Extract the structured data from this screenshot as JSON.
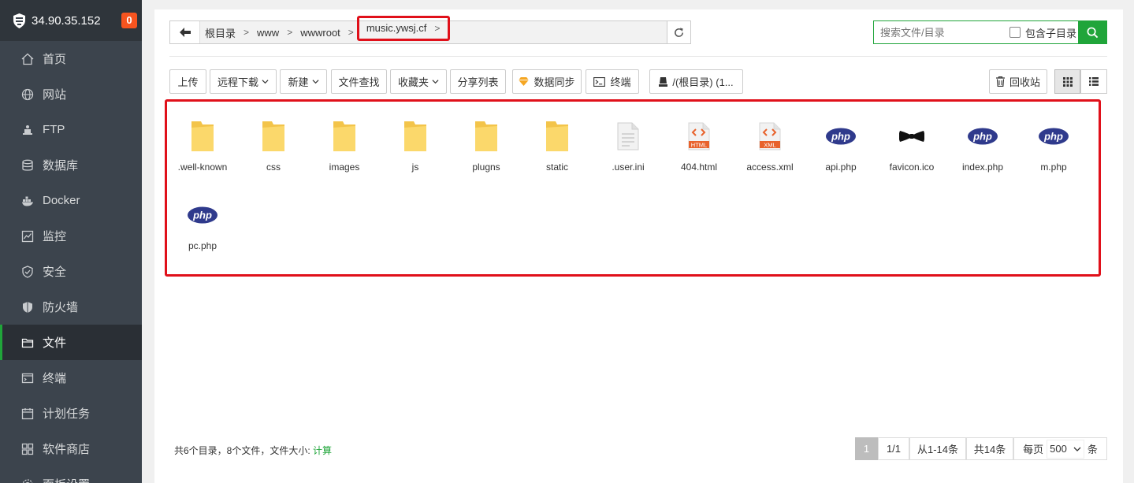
{
  "server": {
    "ip": "34.90.35.152",
    "badge": "0"
  },
  "sidebar": {
    "items": [
      {
        "label": "首页",
        "icon": "home-icon"
      },
      {
        "label": "网站",
        "icon": "globe-icon"
      },
      {
        "label": "FTP",
        "icon": "ftp-icon"
      },
      {
        "label": "数据库",
        "icon": "database-icon"
      },
      {
        "label": "Docker",
        "icon": "docker-icon"
      },
      {
        "label": "监控",
        "icon": "monitor-icon"
      },
      {
        "label": "安全",
        "icon": "shield-icon"
      },
      {
        "label": "防火墙",
        "icon": "firewall-icon"
      },
      {
        "label": "文件",
        "icon": "folder-icon",
        "active": true
      },
      {
        "label": "终端",
        "icon": "terminal-icon"
      },
      {
        "label": "计划任务",
        "icon": "calendar-icon"
      },
      {
        "label": "软件商店",
        "icon": "apps-icon"
      },
      {
        "label": "面板设置",
        "icon": "settings-icon"
      }
    ]
  },
  "path": {
    "crumbs": [
      "根目录",
      "www",
      "wwwroot",
      "music.ywsj.cf"
    ]
  },
  "search": {
    "placeholder": "搜索文件/目录",
    "include_sub_label": "包含子目录"
  },
  "toolbar": {
    "upload": "上传",
    "remote_download": "远程下载",
    "new": "新建",
    "find": "文件查找",
    "favorites": "收藏夹",
    "share_list": "分享列表",
    "data_sync": "数据同步",
    "terminal": "终端",
    "disk": "/(根目录) (1...",
    "recycle": "回收站"
  },
  "files": [
    {
      "name": ".well-known",
      "type": "folder"
    },
    {
      "name": "css",
      "type": "folder"
    },
    {
      "name": "images",
      "type": "folder"
    },
    {
      "name": "js",
      "type": "folder"
    },
    {
      "name": "plugns",
      "type": "folder"
    },
    {
      "name": "static",
      "type": "folder"
    },
    {
      "name": ".user.ini",
      "type": "text"
    },
    {
      "name": "404.html",
      "type": "html"
    },
    {
      "name": "access.xml",
      "type": "xml"
    },
    {
      "name": "api.php",
      "type": "php"
    },
    {
      "name": "favicon.ico",
      "type": "ico"
    },
    {
      "name": "index.php",
      "type": "php"
    },
    {
      "name": "m.php",
      "type": "php"
    },
    {
      "name": "pc.php",
      "type": "php"
    }
  ],
  "footer": {
    "summary": "共6个目录，8个文件，文件大小:",
    "calc": "计算",
    "page_current": "1",
    "page_total": "1/1",
    "range": "从1-14条",
    "total": "共14条",
    "per_page_label": "每页",
    "per_page_value": "500",
    "per_page_unit": "条"
  },
  "colors": {
    "accent": "#20a53a",
    "highlight": "#e0101a",
    "sidebar": "#3c444d",
    "badge": "#f7541f"
  }
}
